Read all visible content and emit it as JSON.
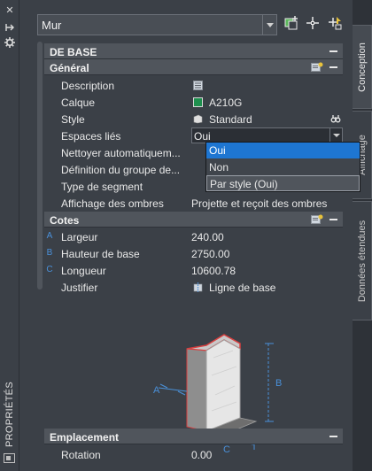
{
  "palette": {
    "title": "PROPRIÉTÉS",
    "object_type": "Mur"
  },
  "tabs": [
    "Conception",
    "Affichage",
    "Données étendues"
  ],
  "sections": {
    "base": "DE BASE",
    "general": "Général",
    "cotes": "Cotes",
    "emplacement": "Emplacement"
  },
  "general": {
    "description": {
      "label": "Description",
      "value": ""
    },
    "calque": {
      "label": "Calque",
      "value": "A210G"
    },
    "style": {
      "label": "Style",
      "value": "Standard"
    },
    "espaces_lies": {
      "label": "Espaces liés",
      "value": "Oui"
    },
    "nettoyer": {
      "label": "Nettoyer automatiquem..."
    },
    "definition": {
      "label": "Définition du groupe de..."
    },
    "type_segment": {
      "label": "Type de segment"
    },
    "ombres": {
      "label": "Affichage des ombres",
      "value": "Projette et reçoit des ombres"
    }
  },
  "dropdown_options": [
    "Oui",
    "Non",
    "Par style (Oui)"
  ],
  "cotes": {
    "largeur": {
      "sym": "A",
      "label": "Largeur",
      "value": "240.00"
    },
    "hauteur": {
      "sym": "B",
      "label": "Hauteur de base",
      "value": "2750.00"
    },
    "longueur": {
      "sym": "C",
      "label": "Longueur",
      "value": "10600.78"
    },
    "justifier": {
      "label": "Justifier",
      "value": "Ligne de base"
    }
  },
  "diagram_labels": [
    "A",
    "B",
    "C"
  ],
  "emplacement": {
    "rotation": {
      "label": "Rotation",
      "value": "0.00"
    }
  },
  "colors": {
    "background": "#3b4047",
    "section_header": "#50555c",
    "selection": "#1e76d2",
    "layer_swatch": "#1e8f4e",
    "dimension_blue": "#4a90d9",
    "wall_edge_red": "#d94040"
  }
}
